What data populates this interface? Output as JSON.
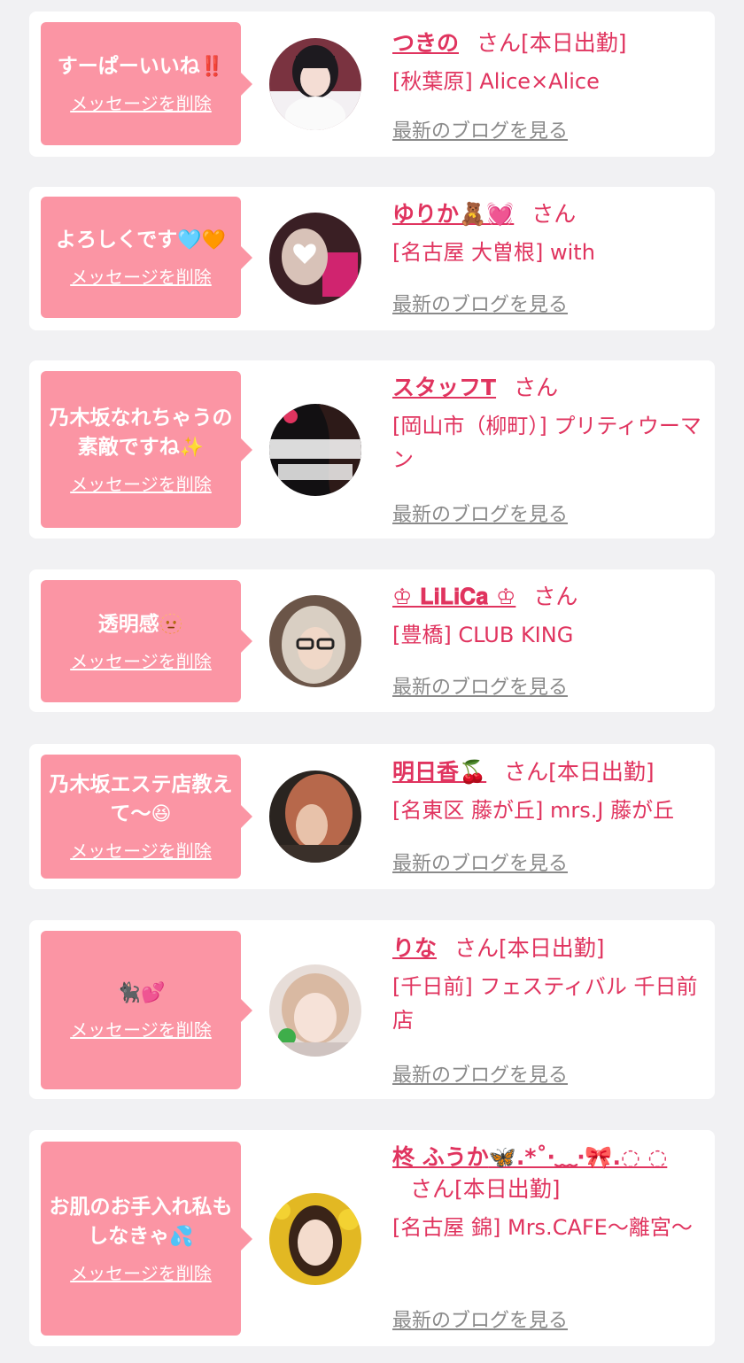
{
  "delete_label": "メッセージを削除",
  "blog_label": "最新のブログを見る",
  "honorific": "さん",
  "colors": {
    "accent": "#e0345f",
    "bubble": "#fb95a4",
    "background": "#f1f1f3",
    "link_gray": "#8a8a8a"
  },
  "messages": [
    {
      "text": "すーぱーいいね",
      "emoji": "‼️",
      "cast_name": "つきの",
      "cast_emoji": "",
      "status": "[本日出勤]",
      "shop": "[秋葉原] Alice×Alice"
    },
    {
      "text": "よろしくです",
      "emoji": "🩵🧡",
      "cast_name": "ゆりか",
      "cast_emoji": "🧸💓",
      "status": "",
      "shop": "[名古屋 大曽根] with"
    },
    {
      "text": "乃木坂なれちゃうの素敵ですね",
      "emoji": "✨",
      "cast_name": "スタッフT",
      "cast_emoji": "",
      "status": "",
      "shop": "[岡山市（柳町）] プリティウーマン"
    },
    {
      "text": "透明感",
      "emoji": "🫥",
      "cast_name": "♔ 𝐋𝐢𝐋𝐢𝐂𝐚 ♔",
      "cast_emoji": "",
      "status": "",
      "shop": "[豊橋] CLUB KING"
    },
    {
      "text": "乃木坂エステ店教えて〜",
      "emoji": "😆",
      "cast_name": "明日香",
      "cast_emoji": "🍒",
      "status": "[本日出勤]",
      "shop": "[名東区 藤が丘] mrs.J 藤が丘"
    },
    {
      "text": "",
      "emoji": "🐈‍⬛💕",
      "cast_name": "りな",
      "cast_emoji": "",
      "status": "[本日出勤]",
      "shop": "[千日前] フェスティバル 千日前店"
    },
    {
      "text": "お肌のお手入れ私もしなきゃ",
      "emoji": "💦",
      "cast_name": "柊 ふうか",
      "cast_emoji": "🦋.*˚‧﹏‧🎀.◌ ◌",
      "status": "[本日出勤]",
      "shop": "[名古屋 錦] Mrs.CAFE〜離宮〜"
    }
  ]
}
